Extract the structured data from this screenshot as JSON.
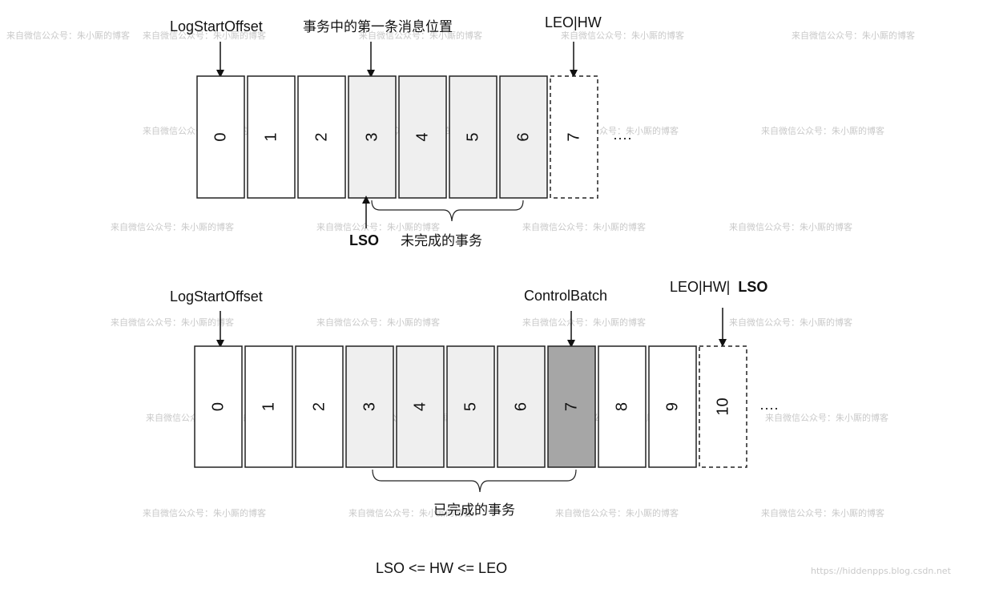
{
  "watermark_text": "来自微信公众号：朱小厮的博客",
  "url_watermark": "https://hiddenpps.blog.csdn.net",
  "top": {
    "log_start_offset_label": "LogStartOffset",
    "first_msg_label": "事务中的第一条消息位置",
    "leo_hw_label": "LEO|HW",
    "cells": [
      "0",
      "1",
      "2",
      "3",
      "4",
      "5",
      "6",
      "7"
    ],
    "ellipsis": "····",
    "lso_label": "LSO",
    "unfinished_label": "未完成的事务"
  },
  "bottom": {
    "log_start_offset_label": "LogStartOffset",
    "control_batch_label": "ControlBatch",
    "leo_hw_label": "LEO|HW|",
    "lso_label": "LSO",
    "cells": [
      "0",
      "1",
      "2",
      "3",
      "4",
      "5",
      "6",
      "7",
      "8",
      "9",
      "10"
    ],
    "ellipsis": "····",
    "finished_label": "已完成的事务"
  },
  "formula": "LSO <= HW <= LEO",
  "colors": {
    "white_cell": "#ffffff",
    "txn_cell": "#efefef",
    "control_cell": "#a6a6a6",
    "stroke": "#222222"
  }
}
